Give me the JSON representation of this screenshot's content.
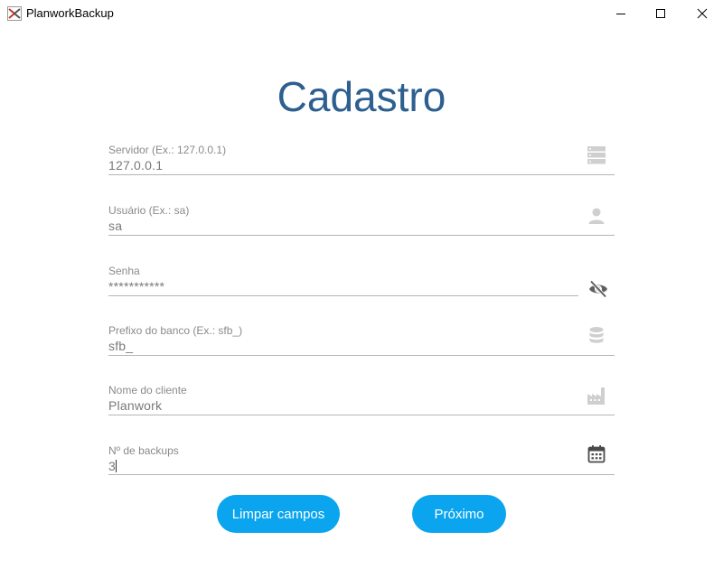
{
  "window": {
    "title": "PlanworkBackup",
    "icon": "planwork-app-icon",
    "controls": [
      "minimize-icon",
      "maximize-icon",
      "close-icon"
    ]
  },
  "page": {
    "title": "Cadastro"
  },
  "fields": [
    {
      "label": "Servidor (Ex.: 127.0.0.1)",
      "value": "127.0.0.1",
      "icon": "server-icon"
    },
    {
      "label": "Usuário (Ex.: sa)",
      "value": "sa",
      "icon": "user-icon"
    },
    {
      "label": "Senha",
      "value": "***********",
      "icon": "eye-off-icon"
    },
    {
      "label": "Prefixo do banco (Ex.: sfb_)",
      "value": "sfb_",
      "icon": "database-icon"
    },
    {
      "label": "Nome do cliente",
      "value": "Planwork",
      "icon": "factory-icon"
    },
    {
      "label": "Nº de backups",
      "value": "3",
      "icon": "calendar-icon"
    }
  ],
  "buttons": {
    "clear_label": "Limpar campos",
    "next_label": "Próximo"
  },
  "colors": {
    "title": "#2d5f8f",
    "button": "#0aa5ee",
    "label": "#8a8a8a",
    "underline": "#b5b5b5"
  }
}
